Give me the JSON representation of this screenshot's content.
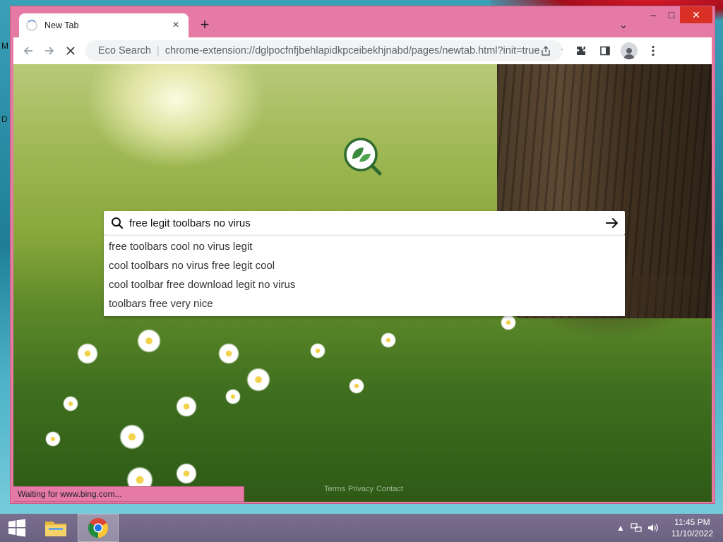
{
  "desktop": {
    "left_letters": [
      "M",
      "D"
    ]
  },
  "window": {
    "tab": {
      "title": "New Tab",
      "close_label": "×"
    },
    "new_tab_label": "+",
    "tab_search_label": "⌄",
    "controls": {
      "minimize": "–",
      "maximize": "□",
      "close": "✕"
    }
  },
  "toolbar": {
    "site_name": "Eco Search",
    "separator": "|",
    "url": "chrome-extension://dglpocfnfjbehlapidkpceibekhjnabd/pages/newtab.html?init=true"
  },
  "page": {
    "search": {
      "value": "free legit toolbars no virus",
      "submit_label": "→"
    },
    "suggestions": [
      "free toolbars cool no virus legit",
      "cool toolbars no virus free legit cool",
      "cool toolbar free download legit no virus",
      "toolbars free very nice"
    ],
    "footer_links": [
      "Terms",
      "Privacy",
      "Contact"
    ],
    "status_text": "Waiting for www.bing.com..."
  },
  "taskbar": {
    "clock_time": "11:45 PM",
    "clock_date": "11/10/2022",
    "tray_chevron": "▲"
  },
  "colors": {
    "window_frame": "#e57aa4",
    "close_button": "#d93025"
  }
}
